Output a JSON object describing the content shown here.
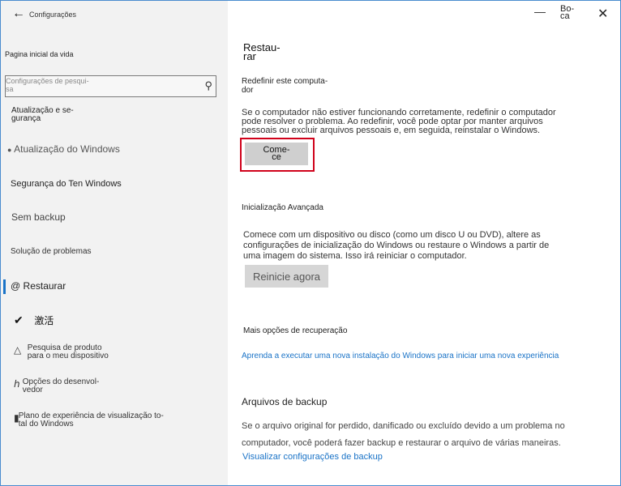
{
  "window": {
    "app_title": "Configurações",
    "minimize_icon": "minimize-icon",
    "titlebar_label": "Bo-\nca",
    "close_icon": "close-icon"
  },
  "sidebar": {
    "home": "Pagina inicial da vida",
    "search_placeholder": "Configurações de pesqui-\nsa",
    "section_heading": "Atualização e se-\ngurança",
    "items": [
      {
        "label": "Atualização do Windows",
        "icon": "bullet-icon"
      },
      {
        "label": "Segurança do Ten Windows"
      },
      {
        "label": "Sem backup"
      },
      {
        "label": "Solução de problemas"
      },
      {
        "label": "Restaurar",
        "icon": "at-icon",
        "active": true
      },
      {
        "label": "激活",
        "icon": "check-circle-icon"
      },
      {
        "label": "Pesquisa de produto\npara o meu dispositivo",
        "icon": "person-icon"
      },
      {
        "label": "Opções do desenvol-\nvedor",
        "icon": "developer-icon"
      },
      {
        "label": "Plano de experiência de visualização to-\ntal do Windows",
        "icon": "insider-icon"
      }
    ],
    "accent_color": "#1a73c7"
  },
  "main": {
    "title": "Restau-\nrar",
    "reset": {
      "heading": "Redefinir este computa-\ndor",
      "description": "Se o computador não estiver funcionando corretamente, redefinir o computador pode resolver o problema. Ao redefinir, você pode optar por manter arquivos pessoais ou excluir arquivos pessoais e, em seguida, reinstalar o Windows.",
      "button": "Come-\nce",
      "highlight_color": "#d0021b"
    },
    "advanced": {
      "heading": "Inicialização Avançada",
      "description": "Comece com um dispositivo ou disco (como um disco U ou DVD), altere as configurações de inicialização do Windows ou restaure o Windows a partir de uma imagem do sistema. Isso irá reiniciar o computador.",
      "button": "Reinicie agora"
    },
    "more": {
      "heading": "Mais opções de recuperação",
      "link": "Aprenda a executar uma nova instalação do Windows para iniciar uma nova experiência"
    },
    "backup": {
      "heading": "Arquivos de backup",
      "description": "Se o arquivo original for perdido, danificado ou excluído devido a um problema no computador, você poderá fazer backup e restaurar o arquivo de várias maneiras.",
      "link": "Visualizar configurações de backup"
    }
  }
}
